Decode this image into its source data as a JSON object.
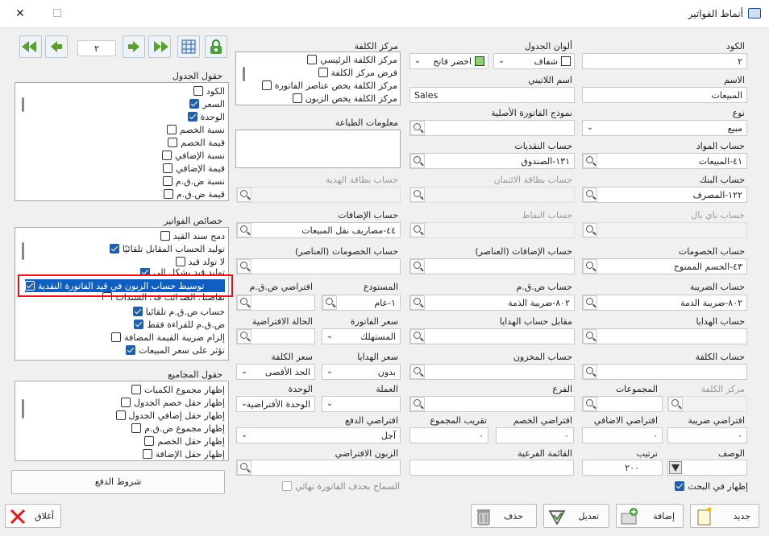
{
  "window": {
    "title": "أنماط الفواتير",
    "close_glyph": "✕"
  },
  "nav": {
    "page_value": "٢"
  },
  "fields": {
    "code": {
      "label": "الكود",
      "value": "٢"
    },
    "name": {
      "label": "الاسم",
      "value": "المبيعات"
    },
    "type": {
      "label": "نوع",
      "value": "مبيع"
    },
    "materials_account": {
      "label": "حساب المواد",
      "value": "٤١-المبيعات"
    },
    "bank_account": {
      "label": "حساب البنك",
      "value": "١٢٢-المصرف"
    },
    "paypal_account": {
      "label": "حساب باي بال",
      "value": ""
    },
    "discounts_account": {
      "label": "حساب الخصومات",
      "value": "٤٣-الحسم الممنوح"
    },
    "tax_account": {
      "label": "حساب الضريبة",
      "value": "٨٠٢-ضريبة الذمة"
    },
    "gifts_account": {
      "label": "حساب الهدايا",
      "value": ""
    },
    "cost_account": {
      "label": "حساب الكلفة",
      "value": ""
    },
    "table_colors": {
      "label": "ألوان الجدول",
      "value": "شفاف"
    },
    "color2": {
      "value": "اخضر فاتح",
      "swatch": "#8bd36b"
    },
    "latin_name": {
      "label": "اسم اللاتيني",
      "value": "Sales"
    },
    "original_invoice_model": {
      "label": "نموذج الفاتورة الأصلية",
      "value": ""
    },
    "cash_account": {
      "label": "حساب النقديات",
      "value": "١٣١-الصندوق"
    },
    "credit_card_account": {
      "label": "حساب بطاقة الائتمان",
      "value": ""
    },
    "points_account": {
      "label": "حساب النقاط",
      "value": ""
    },
    "additions_items_account": {
      "label": "حساب الإضافات (العناصر)",
      "value": ""
    },
    "vat_account": {
      "label": "حساب ض.ق.م",
      "value": "٨٠٢-ضريبة الذمة"
    },
    "gifts_counter_account": {
      "label": "مقابل حساب الهدايا",
      "value": ""
    },
    "inventory_account": {
      "label": "حساب المخزون",
      "value": ""
    },
    "branch": {
      "label": "الفرع",
      "value": ""
    },
    "cost_center": {
      "label": "مركز الكلفة",
      "values": [
        "مركز الكلفة الرئيسي",
        "فرض مركز الكلفة",
        "مركز الكلفة يخص عناصر الفاتورة",
        "مركز الكلفة يخص الزبون"
      ]
    },
    "print_info": {
      "label": "معلومات الطباعة"
    },
    "gift_card_account": {
      "label": "حساب بطاقة الهدية",
      "value": ""
    },
    "additions_account": {
      "label": "حساب الإضافات",
      "value": "٤٤-مصاريف نقل المبيعات"
    },
    "discounts_items_account": {
      "label": "حساب الخصومات (العناصر)",
      "value": ""
    },
    "warehouse": {
      "label": "المستودع",
      "value": "١-عام"
    },
    "default_vat": {
      "label": "افتراضي ض.ق.م",
      "value": ""
    },
    "invoice_price": {
      "label": "سعر الفاتورة",
      "value": "المستهلك"
    },
    "default_state": {
      "label": "الحالة الافتراضية",
      "value": ""
    },
    "gifts_price": {
      "label": "سعر الهدايا",
      "value": "بدون"
    },
    "cost_price": {
      "label": "سعر الكلفة",
      "value": "الحد الأقصى"
    },
    "currency": {
      "label": "العملة",
      "value": ""
    },
    "unit": {
      "label": "الوحدة",
      "value": "الوحدة الأفتراضية"
    },
    "cost_center2": {
      "label": "مركز الكلفة",
      "value": ""
    },
    "groups": {
      "label": "المجموعات",
      "value": ""
    },
    "default_tax": {
      "label": "افتراضي ضريبة",
      "value": "٠"
    },
    "default_addition": {
      "label": "افتراضي الاضافي",
      "value": "٠"
    },
    "default_discount": {
      "label": "افتراضي الخصم",
      "value": "٠"
    },
    "rounding": {
      "label": "تقريب المجموع",
      "value": "٠"
    },
    "default_payment": {
      "label": "افتراضي الدفع",
      "value": "آجل"
    },
    "description": {
      "label": "الوصف",
      "value": ""
    },
    "order": {
      "label": "ترتيب",
      "value": "٢٠٠"
    },
    "sub_list": {
      "label": "القائمة الفرعية",
      "value": ""
    },
    "default_customer": {
      "label": "الزبون الافتراضي",
      "value": ""
    }
  },
  "checks": {
    "show_in_search": {
      "label": "إظهار في البحث",
      "checked": true
    },
    "allow_delete_final": {
      "label": "السماح بحذف الفاتورة نهائي",
      "checked": false
    }
  },
  "table_fields": {
    "title": "حقول الجدول",
    "items": [
      {
        "label": "الكود",
        "checked": false
      },
      {
        "label": "السعر",
        "checked": true
      },
      {
        "label": "الوحدة",
        "checked": true
      },
      {
        "label": "نسبة الخصم",
        "checked": false
      },
      {
        "label": "قيمة الخصم",
        "checked": false
      },
      {
        "label": "نسبة الإضافي",
        "checked": false
      },
      {
        "label": "قيمة الإضافي",
        "checked": false
      },
      {
        "label": "نسبة ض.ق.م",
        "checked": false
      },
      {
        "label": "قيمة ض.ق.م",
        "checked": false
      }
    ]
  },
  "invoice_props": {
    "title": "خصائص الفواتير",
    "items": [
      {
        "label": "دمج سند القيد",
        "checked": false
      },
      {
        "label": "توليد الحساب المقابل تلقائيًا",
        "checked": true
      },
      {
        "label": "لا تولد قيد",
        "checked": false
      },
      {
        "label": "توليد قيد بشكل آلي",
        "checked": true
      },
      {
        "label": "توسيط حساب الزبون في قيد الفاتورة النقدية",
        "checked": true,
        "selected": true
      },
      {
        "label": "تفاصيل الضرائب في السندات",
        "checked": false
      },
      {
        "label": "حساب ض.ق.م تلقائيا",
        "checked": true
      },
      {
        "label": "ض.ق.م للقراءة فقط",
        "checked": true
      },
      {
        "label": "إلزام ضريبة القيمة المضافة",
        "checked": false
      },
      {
        "label": "تؤثر على سعر المبيعات",
        "checked": true
      }
    ]
  },
  "totals_fields": {
    "title": "حقول المجاميع",
    "items": [
      {
        "label": "إظهار مجموع الكميات",
        "checked": false
      },
      {
        "label": "إظهار حقل خصم الجدول",
        "checked": false
      },
      {
        "label": "إظهار حقل إضافي الجدول",
        "checked": false
      },
      {
        "label": "إظهار مجموع ض.ق.م",
        "checked": false
      },
      {
        "label": "إظهار حقل الخصم",
        "checked": false
      },
      {
        "label": "إظهار حقل الإضافة",
        "checked": false
      }
    ]
  },
  "payment_terms_button": "شروط الدفع",
  "buttons": {
    "new": "جديد",
    "add": "إضافة",
    "edit": "تعديل",
    "delete": "حذف",
    "close": "أغلاق"
  }
}
